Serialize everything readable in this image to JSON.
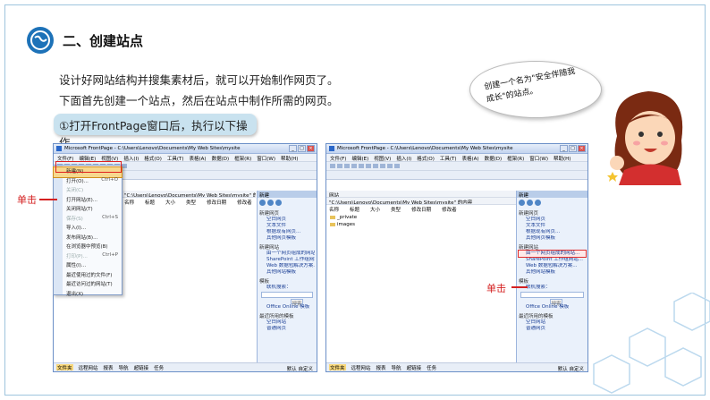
{
  "slide": {
    "section_title": "二、创建站点",
    "para1": "设计好网站结构并搜集素材后，就可以开始制作网页了。",
    "para2": "下面首先创建一个站点，然后在站点中制作所需的网页。",
    "step1": "①打开FrontPage窗口后，执行以下操作。",
    "bubble": "创建一个名为\"安全伴随我成长\"的站点。",
    "click_label_left": "单击",
    "click_label_right": "单击"
  },
  "win1": {
    "title": "Microsoft FrontPage - C:\\Users\\Lenovo\\Documents\\My Web Sites\\mysite",
    "menus": [
      "文件(F)",
      "编辑(E)",
      "视图(V)",
      "插入(I)",
      "格式(O)",
      "工具(T)",
      "表格(A)",
      "数据(D)",
      "框架(R)",
      "窗口(W)",
      "帮助(H)"
    ],
    "path": "\"C:\\Users\\Lenovo\\Documents\\My Web Sites\\mysite\" 的内容",
    "columns": [
      "名称",
      "标题",
      "大小",
      "类型",
      "修改日期",
      "修改者"
    ],
    "file_menu": [
      {
        "label": "新建(N)...",
        "shortcut": "",
        "disabled": false,
        "hl": true
      },
      {
        "label": "打开(O)...",
        "shortcut": "Ctrl+O",
        "disabled": false,
        "hl": false
      },
      {
        "label": "关闭(C)",
        "shortcut": "",
        "disabled": true,
        "hl": false
      },
      {
        "label": "打开网站(E)...",
        "shortcut": "",
        "disabled": false,
        "hl": false
      },
      {
        "label": "关闭网站(T)",
        "shortcut": "",
        "disabled": false,
        "hl": false
      },
      {
        "label": "保存(S)",
        "shortcut": "Ctrl+S",
        "disabled": true,
        "hl": false
      },
      {
        "label": "导入(I)...",
        "shortcut": "",
        "disabled": false,
        "hl": false
      },
      {
        "label": "发布网站(B)...",
        "shortcut": "",
        "disabled": false,
        "hl": false
      },
      {
        "label": "在浏览器中预览(B)",
        "shortcut": "",
        "disabled": false,
        "hl": false
      },
      {
        "label": "打印(P)...",
        "shortcut": "Ctrl+P",
        "disabled": true,
        "hl": false
      },
      {
        "label": "属性(I)...",
        "shortcut": "",
        "disabled": false,
        "hl": false
      },
      {
        "label": "最近使用过的文件(F)",
        "shortcut": "",
        "disabled": false,
        "hl": false
      },
      {
        "label": "最近访问过的网站(T)",
        "shortcut": "",
        "disabled": false,
        "hl": false
      },
      {
        "label": "退出(X)",
        "shortcut": "",
        "disabled": false,
        "hl": false
      }
    ],
    "status": [
      "文件夹",
      "远程网站",
      "报表",
      "导航",
      "超链接",
      "任务"
    ],
    "status_right": "默认  自定义"
  },
  "taskpane": {
    "header": "新建",
    "sec_page": "新建网页",
    "page_links": [
      "空白网页",
      "文本文件",
      "根据现有网页...",
      "其他网页模板"
    ],
    "sec_site": "新建网站",
    "site_links": [
      "由一个网页组成的网站...",
      "SharePoint 工作组网站...",
      "Web 数据包解决方案..."
    ],
    "site_more": "其他网站模板",
    "sec_search": "模板",
    "search_label": "联机搜索：",
    "search_btn": "搜索",
    "office_link": "Office Online 模板",
    "sec_recent": "最近所用的模板",
    "recent": [
      "空白网站",
      "普通网页"
    ]
  },
  "win2": {
    "title": "Microsoft FrontPage - C:\\Users\\Lenovo\\Documents\\My Web Sites\\mysite",
    "menus": [
      "文件(F)",
      "编辑(E)",
      "视图(V)",
      "插入(I)",
      "格式(O)",
      "工具(T)",
      "表格(A)",
      "数据(D)",
      "框架(R)",
      "窗口(W)",
      "帮助(H)"
    ],
    "tab": "网站",
    "path": "\"C:\\Users\\Lenovo\\Documents\\My Web Sites\\mysite\" 的内容",
    "columns": [
      "名称",
      "标题",
      "大小",
      "类型",
      "修改日期",
      "修改者"
    ],
    "folders": [
      "_private",
      "images"
    ],
    "status": [
      "文件夹",
      "远程网站",
      "报表",
      "导航",
      "超链接",
      "任务"
    ],
    "status_right": "默认  自定义"
  },
  "colors": {
    "accent": "#1d72b8",
    "callout": "#d42020",
    "step_bg": "#c9e2ef"
  }
}
